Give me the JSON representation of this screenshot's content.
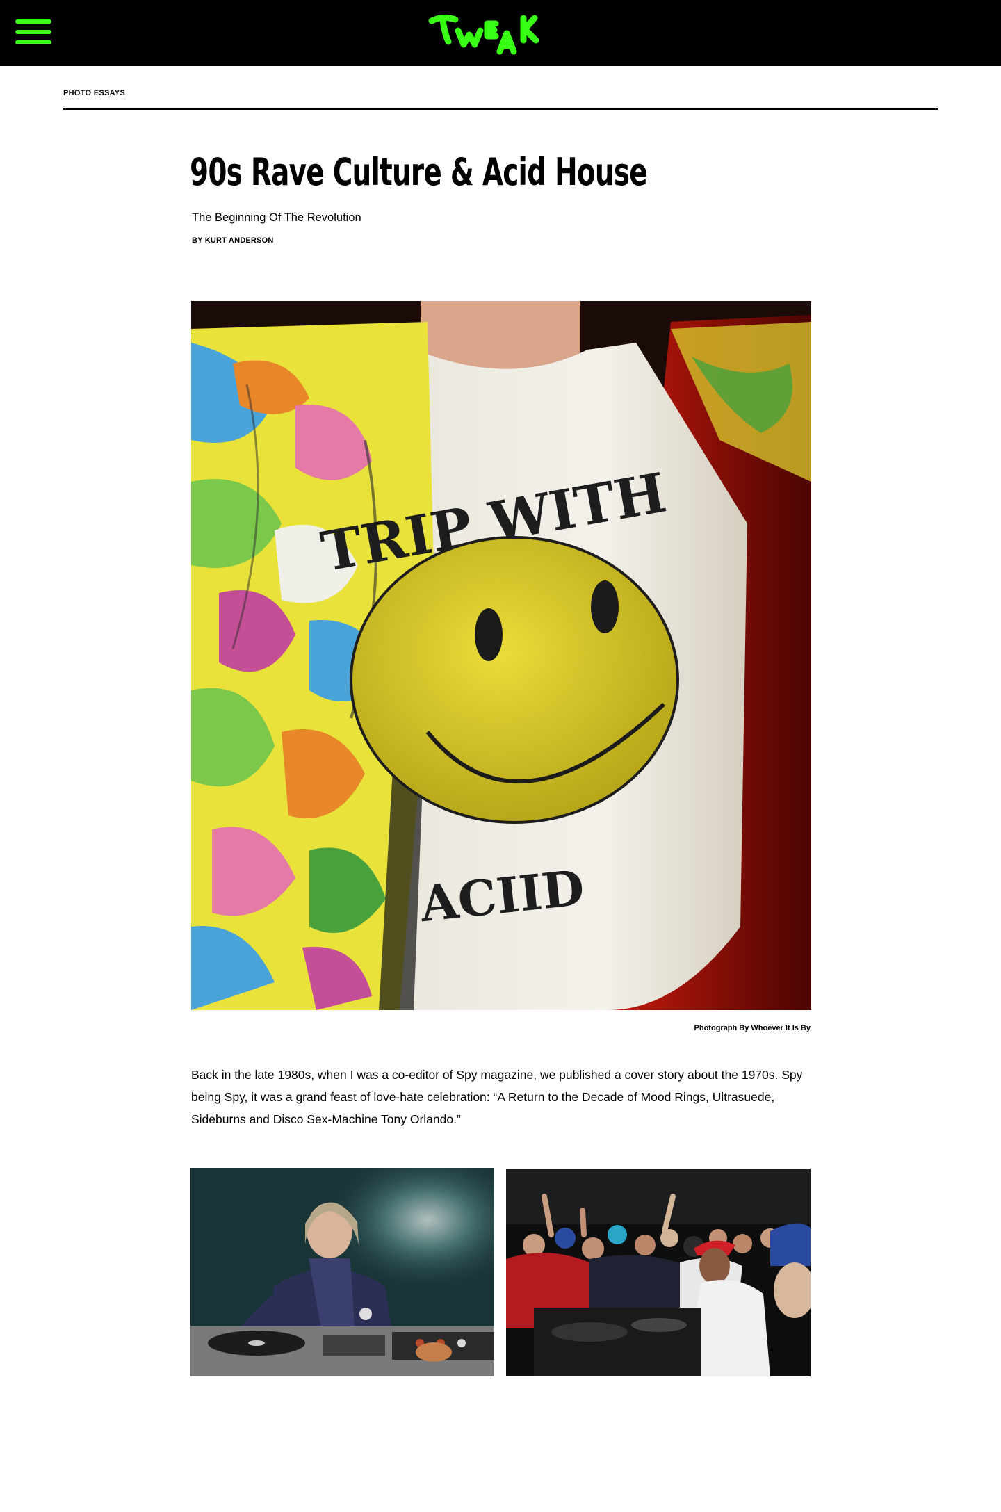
{
  "header": {
    "menu_icon": "hamburger-menu-icon",
    "logo_text": "TWEAK",
    "logo_color": "#39ff14",
    "background": "#000000"
  },
  "section": {
    "label": "PHOTO ESSAYS"
  },
  "article": {
    "title": "90s Rave Culture & Acid House",
    "subtitle": "The Beginning Of The Revolution",
    "byline": "BY KURT ANDERSON",
    "hero_image": {
      "shirt_text_top": "TRIP WITH",
      "shirt_text_bottom": "ACIID",
      "credit": "Photograph By Whoever It Is By"
    },
    "body": "Back in the late 1980s, when I was a co-editor of Spy magazine, we published a cover story about the 1970s. Spy being Spy, it was a grand feast of love-hate celebration: “A Return to the Decade of Mood Rings, Ultrasuede, Sideburns and Disco Sex-Machine Tony Orlando.”"
  }
}
